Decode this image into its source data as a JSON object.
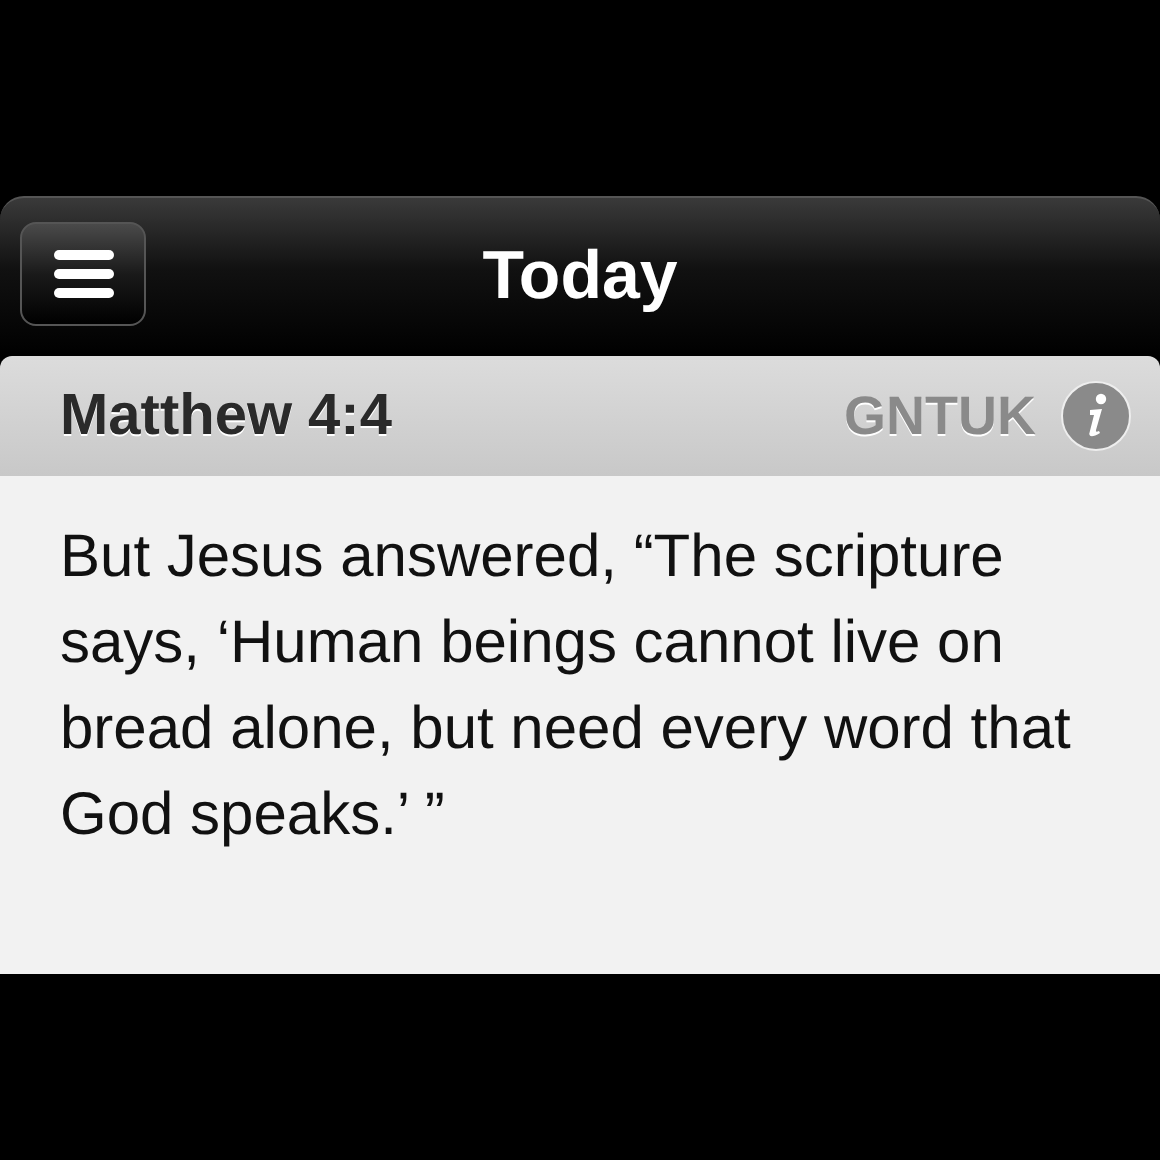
{
  "nav_bar": {
    "title": "Today"
  },
  "verse_header": {
    "reference": "Matthew 4:4",
    "translation": "GNTUK"
  },
  "verse_text": "But Jesus answered, “The scripture says, ‘Human beings cannot live on bread alone, but need every word that God speaks.’ ”"
}
